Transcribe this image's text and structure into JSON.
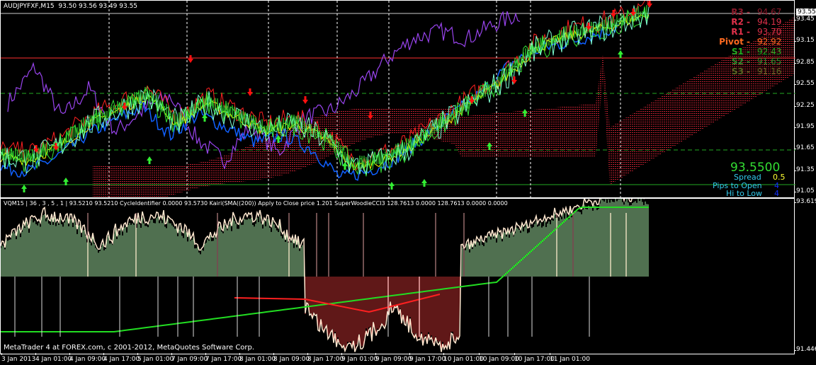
{
  "header": {
    "symbol": "AUDJPYFXF,M15",
    "ohlc": "93.50 93.56 93.49 93.55"
  },
  "current_price": "93.55",
  "price_axis": [
    "93.45",
    "93.15",
    "92.85",
    "92.55",
    "92.25",
    "91.95",
    "91.65",
    "91.35",
    "91.05"
  ],
  "pivots": [
    {
      "label": "R3 -",
      "value": "94.67",
      "color": "#8b1a2a"
    },
    {
      "label": "R2 -",
      "value": "94.19",
      "color": "#e0304a"
    },
    {
      "label": "R1 -",
      "value": "93.70",
      "color": "#e0304a"
    },
    {
      "label": "Pivot -",
      "value": "92.92",
      "color": "#ff6a20"
    },
    {
      "label": "S1 -",
      "value": "92.43",
      "color": "#22aa22"
    },
    {
      "label": "S2 -",
      "value": "91.65",
      "color": "#2a8a2a"
    },
    {
      "label": "S3 -",
      "value": "91.16",
      "color": "#556622"
    }
  ],
  "info": {
    "bid": "93.5500",
    "spread_label": "Spread",
    "spread": "0.5",
    "pips_open_label": "Pips to Open",
    "pips_open": "4",
    "hilo_label": "Hi to Low",
    "hilo": "4"
  },
  "indicator": {
    "header": "VQM15 | 36 , 3 , 5 , 1 | 93.5210 93.5210 CycleIdentifier 0.0000 93.5730 Kairi(SMA((200)) Apply to Close price 1.201 SuperWoodieCCI3 128.7613 0.0000 128.7613 0.0000 0.0000",
    "axis_max": "93.6198",
    "axis_min": "91.4467"
  },
  "copyright": "MetaTrader 4 at FOREX.com, c 2001-2012, MetaQuotes Software Corp.",
  "time_axis": [
    "3 Jan 2013",
    "4 Jan 01:00",
    "4 Jan 09:00",
    "4 Jan 17:00",
    "5 Jan 01:00",
    "7 Jan 09:00",
    "7 Jan 17:00",
    "8 Jan 01:00",
    "8 Jan 09:00",
    "8 Jan 17:00",
    "9 Jan 01:00",
    "9 Jan 09:00",
    "9 Jan 17:00",
    "10 Jan 01:00",
    "10 Jan 09:00",
    "10 Jan 17:00",
    "11 Jan 01:00"
  ],
  "series": {
    "price": [
      91.55,
      91.5,
      91.7,
      92.0,
      92.2,
      92.4,
      92.0,
      92.3,
      92.1,
      91.9,
      92.0,
      91.8,
      91.4,
      91.5,
      91.7,
      92.0,
      92.3,
      92.6,
      93.0,
      93.2,
      93.3,
      93.4,
      93.55
    ],
    "purple": [
      92.3,
      92.8,
      92.1,
      92.5,
      91.9,
      92.2,
      92.4,
      91.8,
      91.5,
      92.0,
      91.6,
      92.1,
      92.2,
      92.5,
      92.9,
      93.2,
      93.3,
      93.2,
      93.4,
      93.55
    ],
    "colors": {
      "price": "#7fffd4",
      "green": "#33dd33",
      "purple": "#9944ee",
      "yellow": "#ffff00",
      "blue": "#1060ff",
      "red": "#ff2020",
      "cloud": "#c02030"
    }
  }
}
